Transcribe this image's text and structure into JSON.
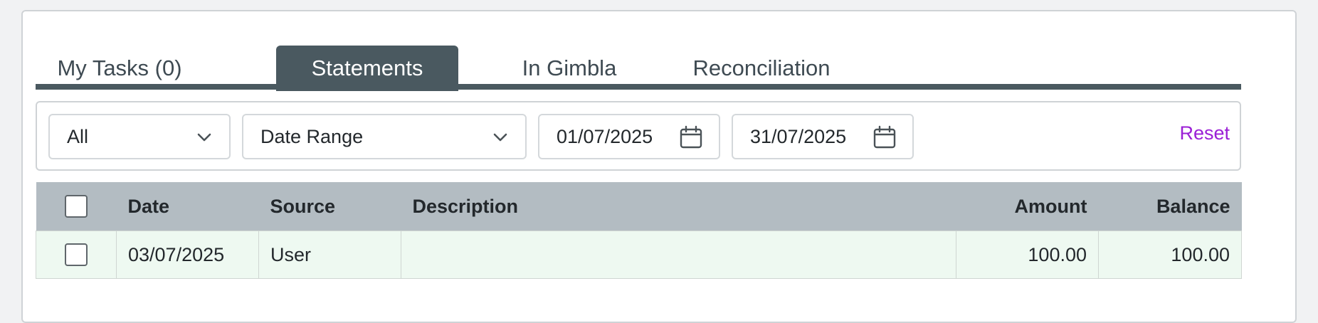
{
  "tabs": [
    {
      "label": "My Tasks (0)"
    },
    {
      "label": "Statements"
    },
    {
      "label": "In Gimbla"
    },
    {
      "label": "Reconciliation"
    }
  ],
  "active_tab": "Statements",
  "filters": {
    "type_select": "All",
    "period_select": "Date Range",
    "date_from": "01/07/2025",
    "date_to": "31/07/2025",
    "reset_label": "Reset"
  },
  "table": {
    "headers": {
      "date": "Date",
      "source": "Source",
      "description": "Description",
      "amount": "Amount",
      "balance": "Balance"
    },
    "rows": [
      {
        "date": "03/07/2025",
        "source": "User",
        "description": "",
        "amount": "100.00",
        "balance": "100.00"
      }
    ]
  },
  "colors": {
    "accent_dark": "#4a5960",
    "reset_link": "#9b1fd6",
    "header_bg": "#b3bcc2",
    "row_bg": "#eef9f1"
  }
}
